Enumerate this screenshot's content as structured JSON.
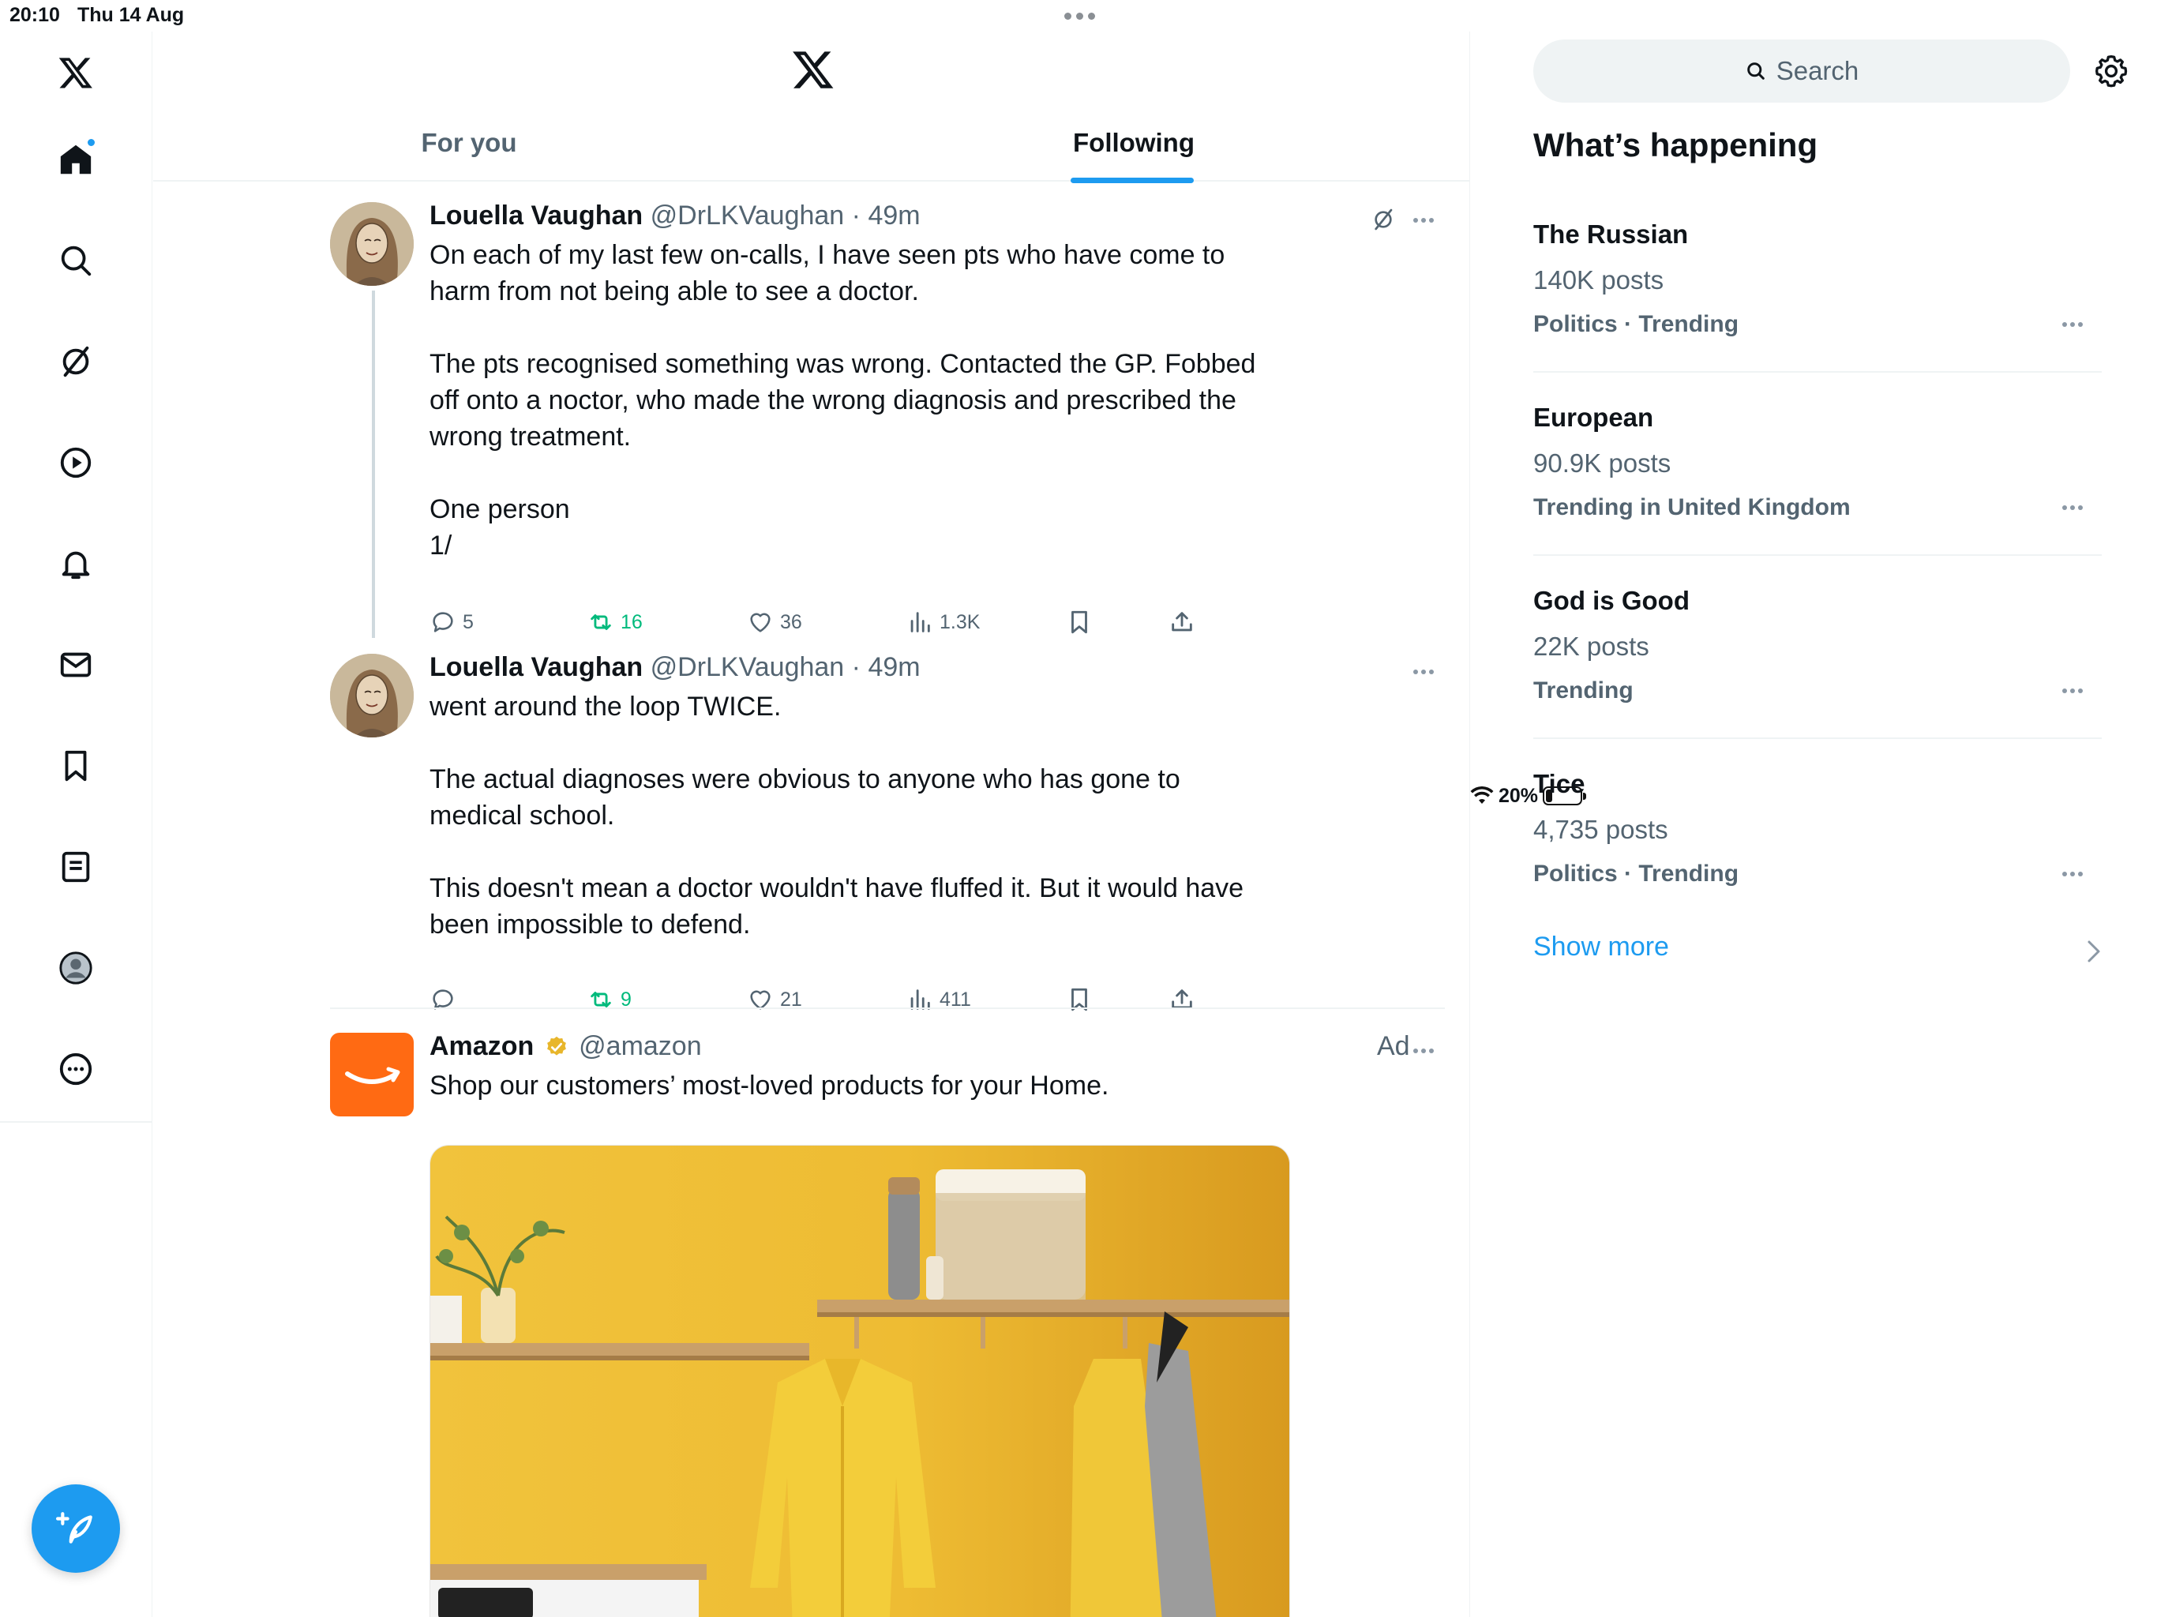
{
  "status_bar": {
    "time": "20:10",
    "date": "Thu 14 Aug",
    "battery_text": "20%",
    "battery_level": 0.2
  },
  "nav": {
    "items": [
      "x-logo",
      "home",
      "explore",
      "grok",
      "video",
      "notifications",
      "messages",
      "bookmarks",
      "lists",
      "profile",
      "more"
    ],
    "accent": "#1d9bf0"
  },
  "tabs": [
    {
      "label": "For you",
      "active": false
    },
    {
      "label": "Following",
      "active": true
    }
  ],
  "tweets": [
    {
      "name": "Louella Vaughan",
      "handle": "@DrLKVaughan",
      "time": "49m",
      "text": "On each of my last few on-calls, I have seen pts who have come to\nharm from not being able to see a doctor.\n\nThe pts recognised something was wrong. Contacted the GP. Fobbed\noff onto a noctor, who made the wrong diagnosis and prescribed the\nwrong treatment.\n\nOne person\n1/",
      "replies": "5",
      "reposts": "16",
      "likes": "36",
      "views": "1.3K"
    },
    {
      "name": "Louella Vaughan",
      "handle": "@DrLKVaughan",
      "time": "49m",
      "text": "went around the loop TWICE.\n\nThe actual diagnoses were obvious to anyone who has gone to\nmedical school.\n\nThis doesn't mean a doctor wouldn't have fluffed it. But it would have\nbeen impossible to defend.",
      "replies": "",
      "reposts": "9",
      "likes": "21",
      "views": "411"
    }
  ],
  "ad": {
    "name": "Amazon",
    "handle": "@amazon",
    "label": "Ad",
    "text": "Shop our customers’ most-loved products for your Home."
  },
  "sidebar": {
    "search_placeholder": "Search",
    "heading": "What’s happening",
    "trends": [
      {
        "name": "The Russian",
        "count": "140K posts",
        "meta": "Politics · Trending"
      },
      {
        "name": "European",
        "count": "90.9K posts",
        "meta": "Trending in United Kingdom"
      },
      {
        "name": "God is Good",
        "count": "22K posts",
        "meta": "Trending"
      },
      {
        "name": "Tice",
        "count": "4,735 posts",
        "meta": "Politics · Trending"
      }
    ],
    "show_more": "Show more"
  }
}
